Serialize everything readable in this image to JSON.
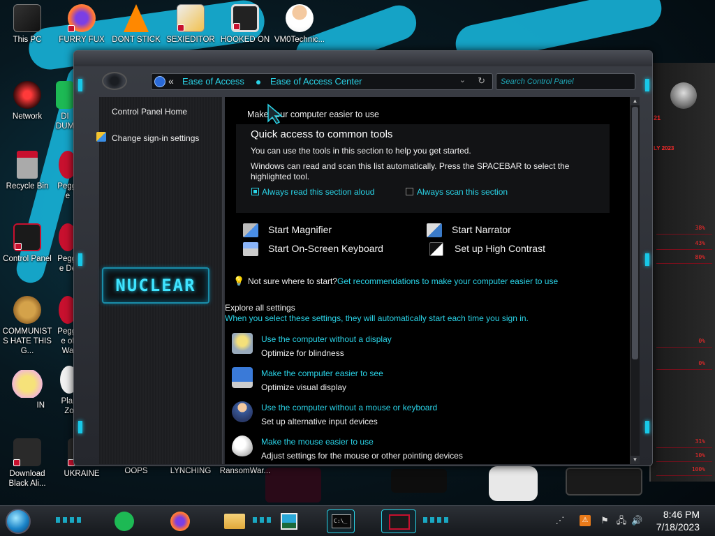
{
  "desktop": {
    "icons": [
      {
        "id": "this-pc",
        "label": "This PC"
      },
      {
        "id": "furry-fux",
        "label": "FURRY FUX"
      },
      {
        "id": "dont-stick",
        "label": "DONT STICK"
      },
      {
        "id": "sexieditor",
        "label": "SEXIEDITOR"
      },
      {
        "id": "hooked-on",
        "label": "HOOKED ON"
      },
      {
        "id": "vm0technic",
        "label": "VM0Technic..."
      },
      {
        "id": "network",
        "label": "Network"
      },
      {
        "id": "recycle-bin",
        "label": "Recycle Bin"
      },
      {
        "id": "control-panel",
        "label": "Control Panel"
      },
      {
        "id": "communists",
        "label": "COMMUNISTS HATE THIS G..."
      },
      {
        "id": "download",
        "label": "Download Black Ali..."
      },
      {
        "id": "ukraine",
        "label": "UKRAINE"
      },
      {
        "id": "oops",
        "label": "OOPS"
      },
      {
        "id": "lynching",
        "label": "LYNCHING"
      },
      {
        "id": "ransomware",
        "label": "RansomWar..."
      },
      {
        "id": "di-dum",
        "label": "DI DUM"
      },
      {
        "id": "peggle-1",
        "label": "Peggle"
      },
      {
        "id": "peggle-2",
        "label": "Peggle De"
      },
      {
        "id": "peggle-3",
        "label": "Peggle of Wa"
      },
      {
        "id": "in",
        "label": "IN"
      },
      {
        "id": "plan-zo",
        "label": "Plan Zo"
      }
    ],
    "gadget": {
      "date_text": "LY 2023",
      "values": [
        "38%",
        "43%",
        "80%",
        "0%",
        "0%",
        "31%",
        "10%",
        "100%"
      ],
      "top_value": "21"
    }
  },
  "window": {
    "address": {
      "chevron": "«",
      "crumbs": [
        "Ease of Access",
        "Ease of Access Center"
      ],
      "dropdown": "⌄",
      "refresh": "↻"
    },
    "search": {
      "placeholder": "Search Control Panel"
    },
    "left_pane": {
      "home_link": "Control Panel Home",
      "signin_link": "Change sign-in settings",
      "logo_text": "NUCLEAR"
    },
    "main": {
      "heading": "Make your computer easier to use",
      "quick_access": {
        "title": "Quick access to common tools",
        "intro": "You can use the tools in this section to help you get started.",
        "scan_text_1": "Windows can read and scan this list automatically.  Press the SPACEBAR to select the",
        "scan_text_2": "highlighted tool.",
        "read_aloud": {
          "label": "Always read this section aloud",
          "checked": true
        },
        "scan": {
          "label": "Always scan this section",
          "checked": false
        }
      },
      "tools": [
        {
          "label": "Start Magnifier",
          "icon": "magnifier-icon"
        },
        {
          "label": "Start Narrator",
          "icon": "narrator-icon"
        },
        {
          "label": "Start On-Screen Keyboard",
          "icon": "keyboard-icon"
        },
        {
          "label": "Set up High Contrast",
          "icon": "contrast-icon"
        }
      ],
      "hint": {
        "prefix": "Not sure where to start?",
        "link": "Get recommendations to make your computer easier to use"
      },
      "explore": {
        "title": "Explore all settings",
        "subtitle": "When you select these settings, they will automatically start each time you sign in."
      },
      "settings": [
        {
          "link": "Use the computer without a display",
          "desc": "Optimize for blindness",
          "icon": "display-off-icon"
        },
        {
          "link": "Make the computer easier to see",
          "desc": "Optimize visual display",
          "icon": "monitor-icon"
        },
        {
          "link": "Use the computer without a mouse or keyboard",
          "desc": "Set up alternative input devices",
          "icon": "person-headset-icon"
        },
        {
          "link": "Make the mouse easier to use",
          "desc": "Adjust settings for the mouse or other pointing devices",
          "icon": "mouse-icon"
        }
      ]
    }
  },
  "taskbar": {
    "apps": [
      {
        "id": "spotify",
        "color": "#1db954"
      },
      {
        "id": "firefox",
        "color": "#ff7139"
      },
      {
        "id": "file-explorer",
        "color": "#f2c14e"
      },
      {
        "id": "photos",
        "color": "#2aa8d8"
      },
      {
        "id": "cmd",
        "color": "#1a1a1a"
      },
      {
        "id": "control-panel",
        "color": "#c8102e"
      }
    ],
    "clock": {
      "time": "8:46 PM",
      "date": "7/18/2023"
    }
  },
  "colors": {
    "accent": "#2ad4e8",
    "link": "#2ad4e8",
    "window_bg": "#000000",
    "alert_red": "#c8102e"
  }
}
